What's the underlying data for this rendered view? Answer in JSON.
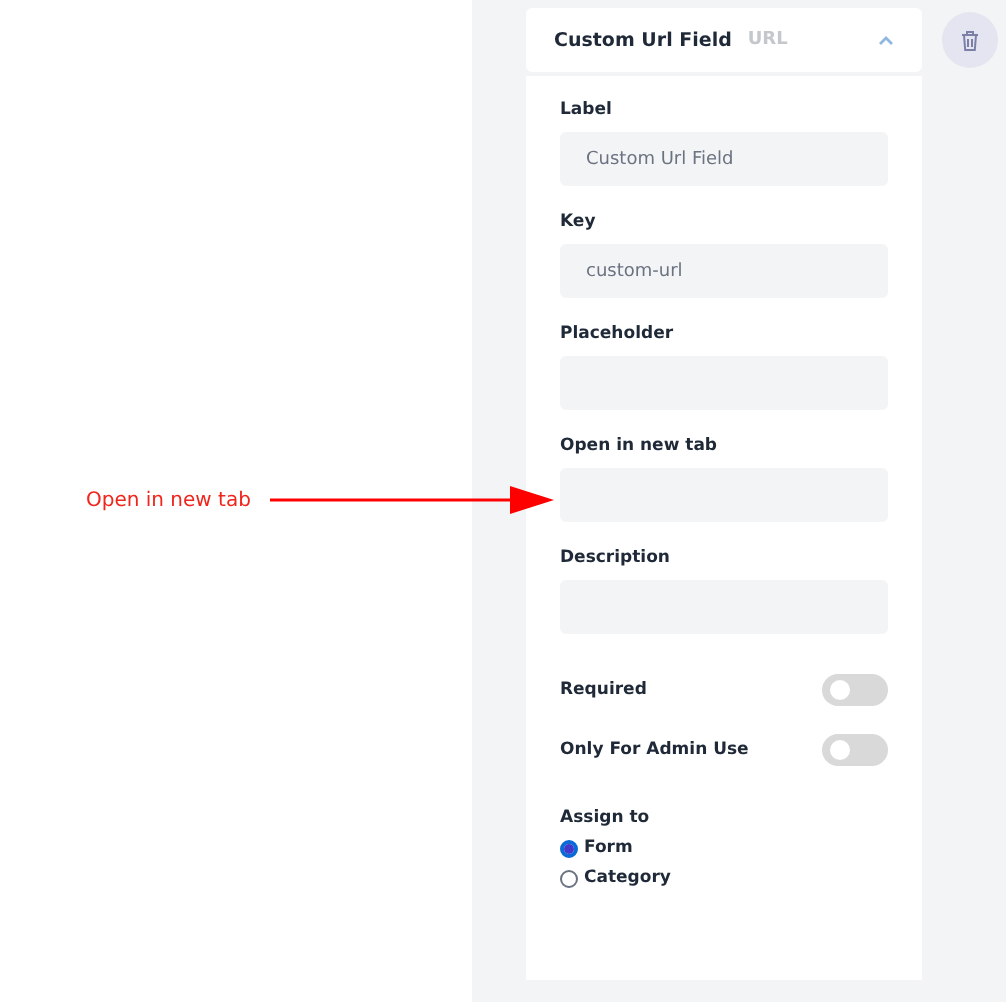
{
  "annotation": {
    "text": "Open in new tab"
  },
  "card": {
    "title": "Custom Url Field",
    "type_badge": "URL",
    "expanded": true
  },
  "fields": [
    {
      "label": "Label",
      "value": "Custom Url Field"
    },
    {
      "label": "Key",
      "value": "custom-url"
    },
    {
      "label": "Placeholder"
    },
    {
      "label": "Open in new tab"
    },
    {
      "label": "Description"
    }
  ],
  "toggles": [
    {
      "label": "Required",
      "on": false
    },
    {
      "label": "Only For Admin Use",
      "on": false
    }
  ],
  "assign": {
    "label": "Assign to",
    "options": [
      {
        "label": "Form",
        "selected": true
      },
      {
        "label": "Category",
        "selected": false
      }
    ]
  }
}
